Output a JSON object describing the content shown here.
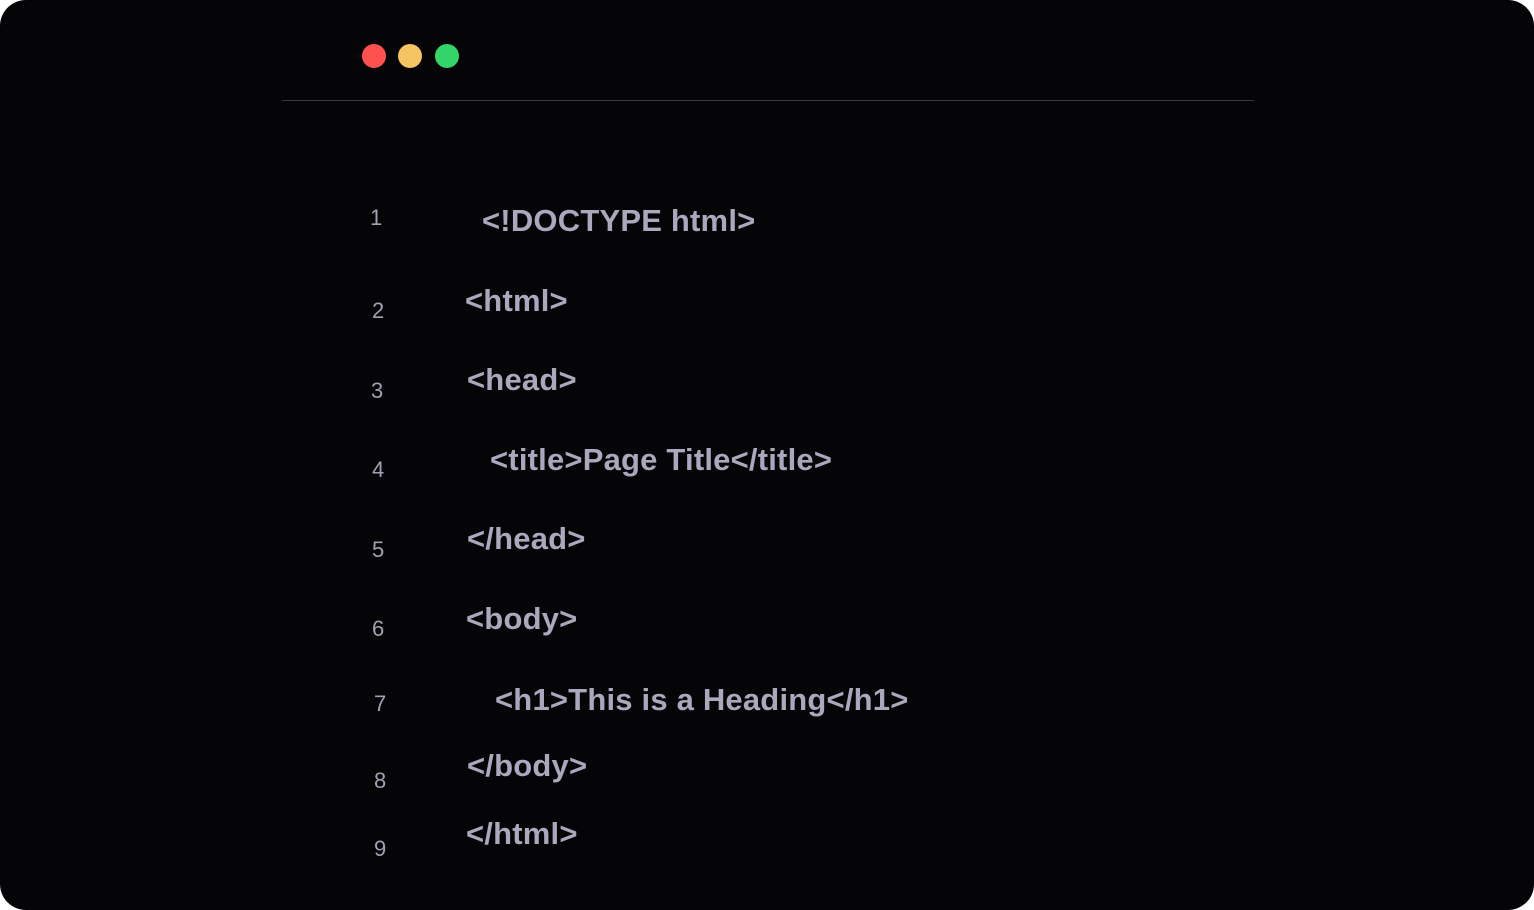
{
  "colors": {
    "background": "#050407",
    "close": "#fe5150",
    "minimize": "#f5c561",
    "maximize": "#33d46a",
    "divider": "#3b3b3f",
    "line_number": "#a2a1b2",
    "code_text": "#a9a8bc"
  },
  "editor": {
    "lines": [
      {
        "number": "1",
        "code": "<!DOCTYPE html>"
      },
      {
        "number": "2",
        "code": "<html>"
      },
      {
        "number": "3",
        "code": "<head>"
      },
      {
        "number": "4",
        "code": "<title>Page Title</title>"
      },
      {
        "number": "5",
        "code": "</head>"
      },
      {
        "number": "6",
        "code": "<body>"
      },
      {
        "number": "7",
        "code": "<h1>This is a Heading</h1>"
      },
      {
        "number": "8",
        "code": "</body>"
      },
      {
        "number": "9",
        "code": "</html>"
      }
    ]
  }
}
